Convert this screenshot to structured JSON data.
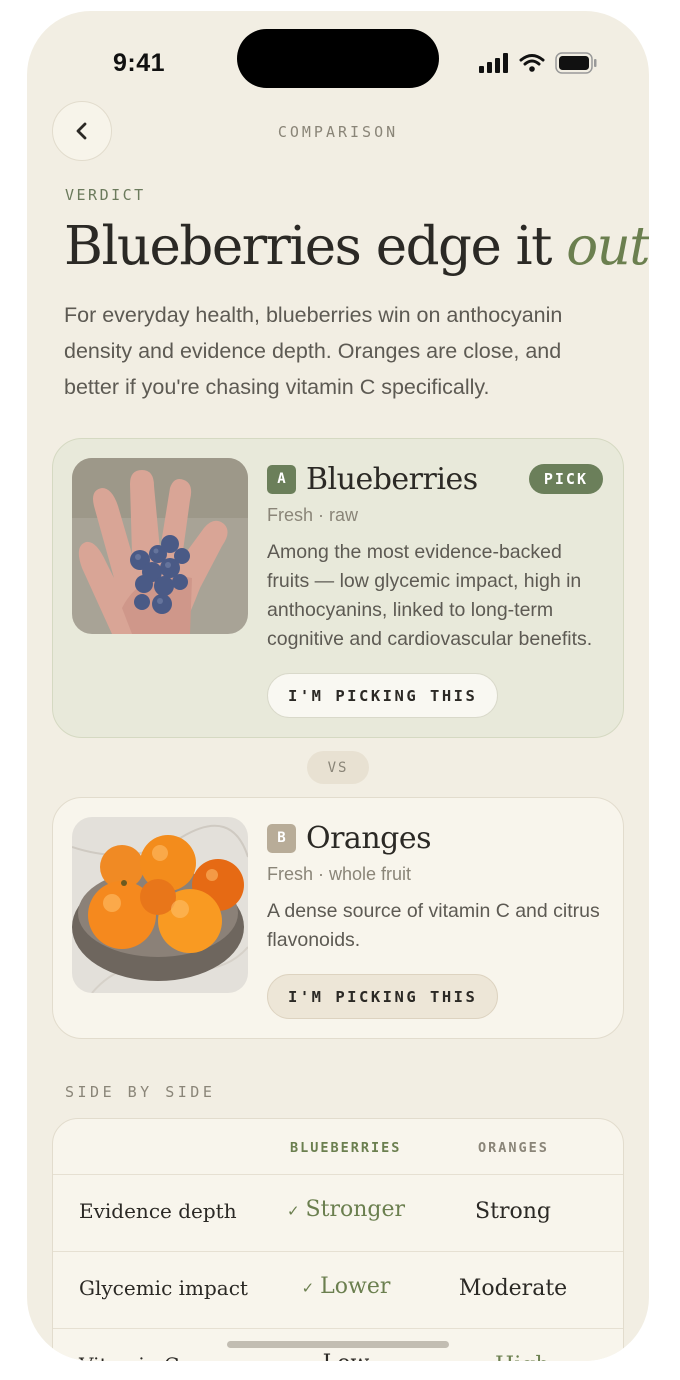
{
  "status_bar": {
    "time": "9:41"
  },
  "nav": {
    "title": "COMPARISON"
  },
  "verdict": {
    "label": "VERDICT",
    "headline": "Blueberries edge it",
    "headline_emphasis": "out",
    "body": "For everyday health, blueberries win on anthocyanin density and evidence depth. Oranges are close, and better if you're chasing vitamin C specifically."
  },
  "options": [
    {
      "letter": "A",
      "name": "Blueberries",
      "badge": "PICK",
      "subtitle": "Fresh · raw",
      "description": "Among the most evidence-backed fruits — low glycemic impact, high in anthocyanins, linked to long-term cognitive and cardiovascular benefits.",
      "button": "I'M PICKING THIS",
      "image": "blueberries-in-hand"
    },
    {
      "letter": "B",
      "name": "Oranges",
      "subtitle": "Fresh · whole fruit",
      "description": "A dense source of vitamin C and citrus flavonoids.",
      "button": "I'M PICKING THIS",
      "image": "oranges-in-bowl"
    }
  ],
  "vs": "VS",
  "side_by_side": {
    "label": "SIDE BY SIDE",
    "headers": [
      "BLUEBERRIES",
      "ORANGES"
    ],
    "rows": [
      {
        "label": "Evidence depth",
        "a": "Stronger",
        "b": "Strong"
      },
      {
        "label": "Glycemic impact",
        "a": "Lower",
        "b": "Moderate"
      },
      {
        "label": "Vitamin C",
        "a": "Low",
        "b": "High"
      }
    ]
  },
  "colors": {
    "accent": "#6b7f4f",
    "background": "#f2eee3",
    "pick_card": "#e8e9da"
  }
}
